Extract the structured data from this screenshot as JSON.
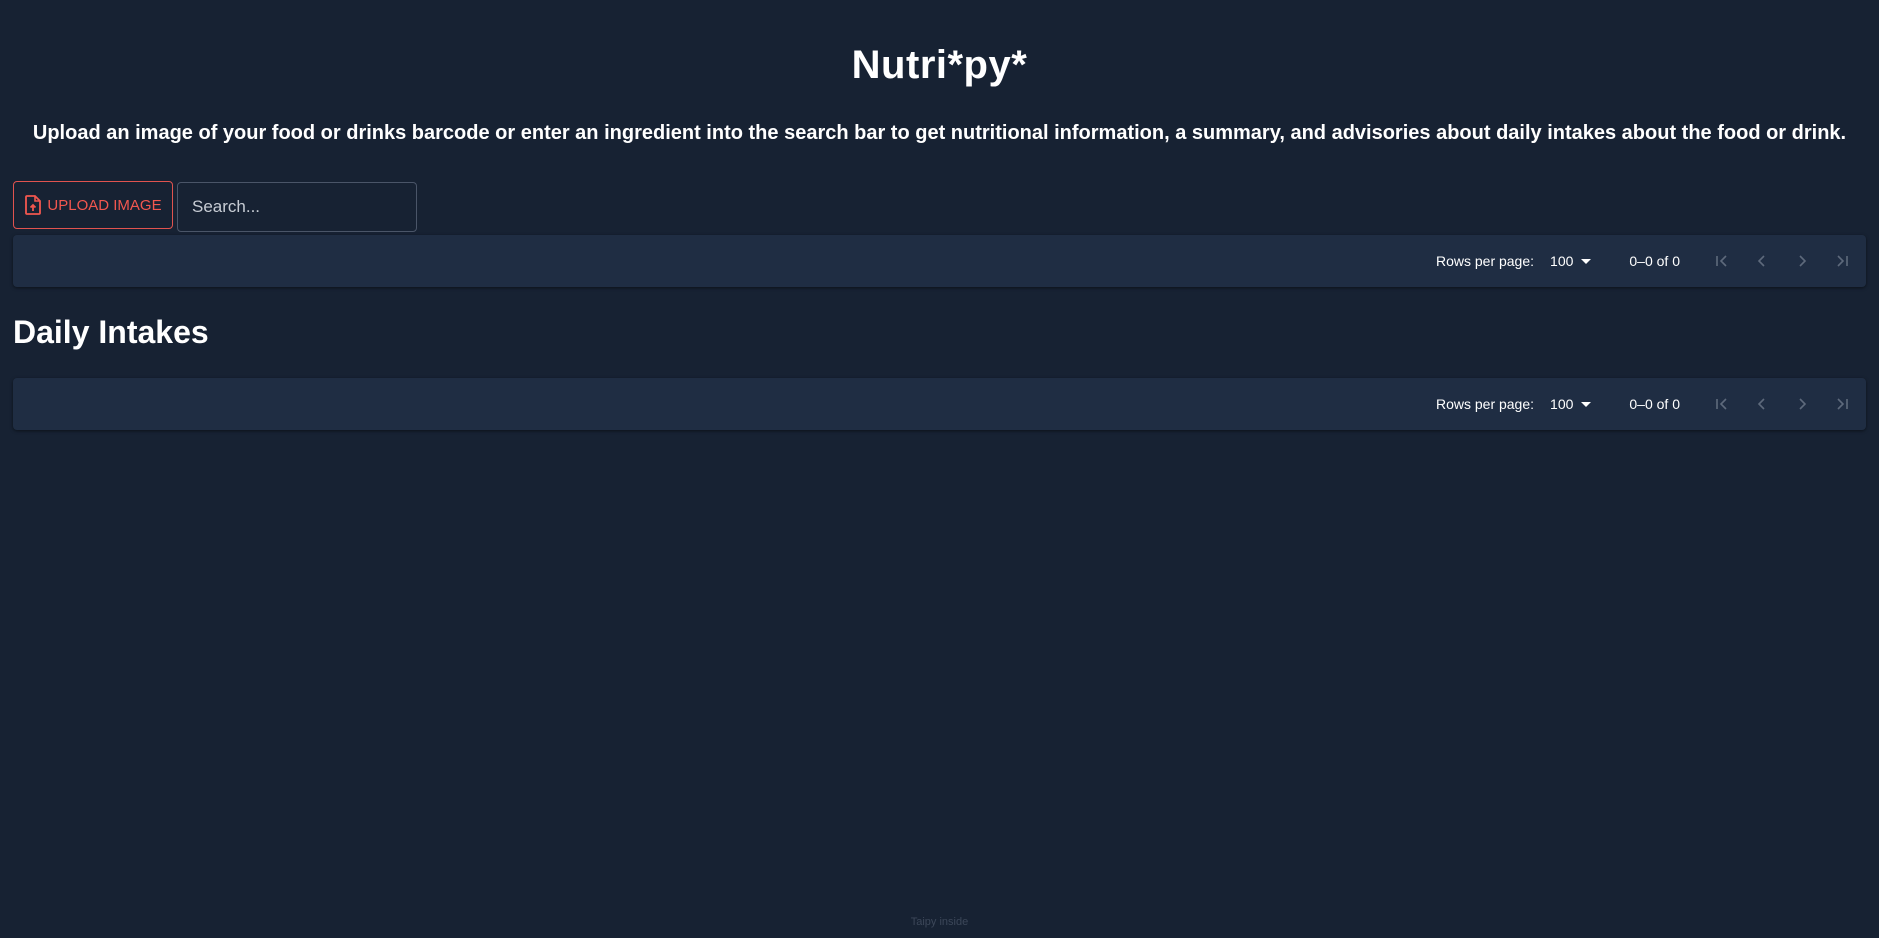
{
  "header": {
    "title": "Nutri*py*",
    "subtitle": "Upload an image of your food or drinks barcode or enter an ingredient into the search bar to get nutritional information, a summary, and advisories about daily intakes about the food or drink."
  },
  "toolbar": {
    "upload_label": "UPLOAD IMAGE",
    "upload_icon": "file-upload-icon",
    "search_placeholder": "Search..."
  },
  "results_table": {
    "rows_per_page_label": "Rows per page:",
    "rows_per_page_value": "100",
    "range_text": "0–0 of 0"
  },
  "daily_intakes": {
    "heading": "Daily Intakes",
    "rows_per_page_label": "Rows per page:",
    "rows_per_page_value": "100",
    "range_text": "0–0 of 0"
  },
  "footer": {
    "text": "Taipy inside"
  },
  "colors": {
    "background": "#172233",
    "panel": "#1f2d43",
    "accent": "#f2574f",
    "disabled_icon": "#5e6a7c"
  }
}
